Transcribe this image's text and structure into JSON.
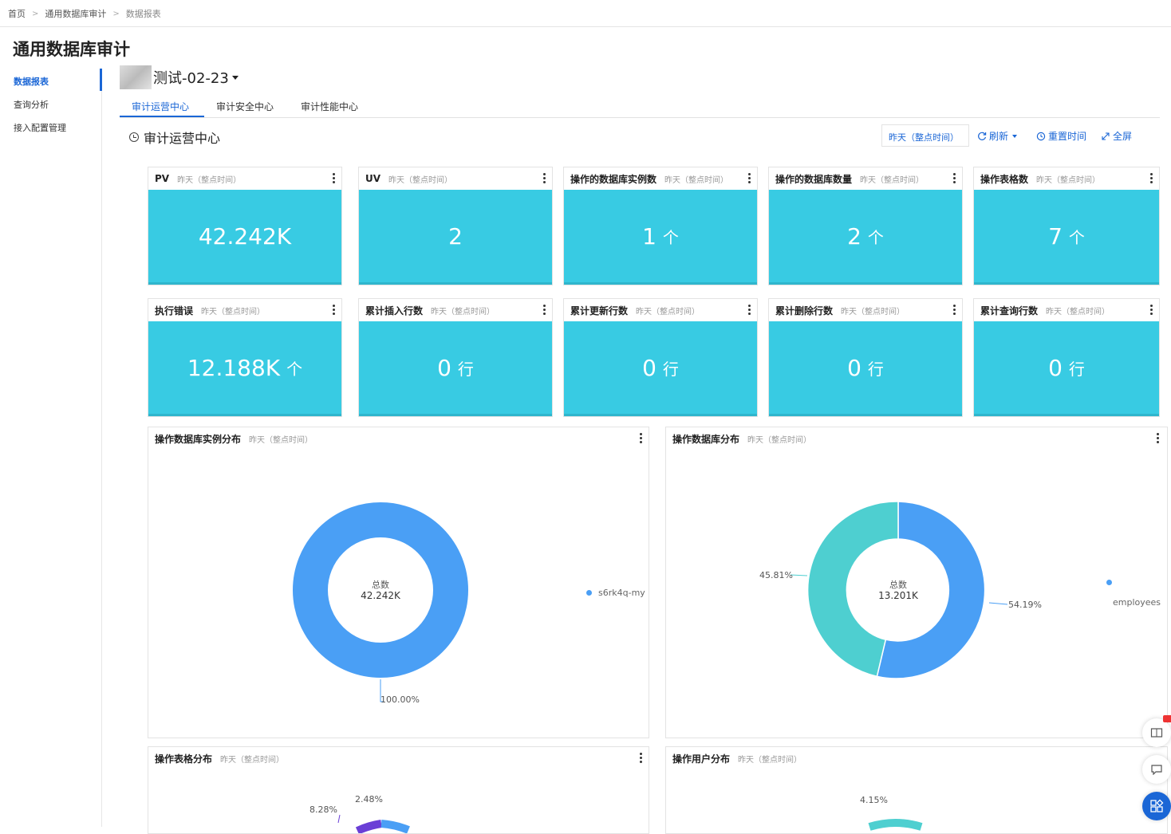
{
  "breadcrumb": [
    "首页",
    "通用数据库审计",
    "数据报表"
  ],
  "page_title": "通用数据库审计",
  "sidebar": {
    "items": [
      {
        "label": "数据报表",
        "active": true
      },
      {
        "label": "查询分析"
      },
      {
        "label": "接入配置管理"
      }
    ]
  },
  "dashboard": {
    "name_suffix": "测试-02-23"
  },
  "tabs": [
    {
      "label": "审计运营中心",
      "active": true
    },
    {
      "label": "审计安全中心"
    },
    {
      "label": "审计性能中心"
    }
  ],
  "section": {
    "title": "审计运营中心"
  },
  "toolbar": {
    "time_range": "昨天（整点时间）",
    "refresh": "刷新",
    "reset_time": "重置时间",
    "fullscreen": "全屏"
  },
  "card_subtitle": "昨天（整点时间）",
  "kpis": [
    {
      "title": "PV",
      "value": "42.242K",
      "unit": ""
    },
    {
      "title": "UV",
      "value": "2",
      "unit": ""
    },
    {
      "title": "操作的数据库实例数",
      "value": "1",
      "unit": "个"
    },
    {
      "title": "操作的数据库数量",
      "value": "2",
      "unit": "个"
    },
    {
      "title": "操作表格数",
      "value": "7",
      "unit": "个"
    },
    {
      "title": "执行错误",
      "value": "12.188K",
      "unit": "个"
    },
    {
      "title": "累计插入行数",
      "value": "0",
      "unit": "行"
    },
    {
      "title": "累计更新行数",
      "value": "0",
      "unit": "行"
    },
    {
      "title": "累计删除行数",
      "value": "0",
      "unit": "行"
    },
    {
      "title": "累计查询行数",
      "value": "0",
      "unit": "行"
    }
  ],
  "charts": {
    "instance_dist": {
      "title": "操作数据库实例分布",
      "center_label": "总数",
      "center_value": "42.242K",
      "legend": [
        "s6rk4q-my"
      ],
      "pct_labels": [
        "100.00%"
      ]
    },
    "db_dist": {
      "title": "操作数据库分布",
      "center_label": "总数",
      "center_value": "13.201K",
      "legend": [
        "",
        "employees"
      ],
      "pct_labels": [
        "45.81%",
        "54.19%"
      ]
    },
    "table_dist": {
      "title": "操作表格分布",
      "pct_labels": [
        "8.28%",
        "2.48%"
      ]
    },
    "user_dist": {
      "title": "操作用户分布",
      "pct_labels": [
        "4.15%"
      ]
    }
  },
  "colors": {
    "accent": "#1a66d6",
    "kpi": "#38cbe3",
    "donut_blue": "#4a9ff5",
    "donut_teal": "#4ecfd0"
  },
  "chart_data": [
    {
      "type": "pie",
      "title": "操作数据库实例分布",
      "categories": [
        "s6rk4q-my"
      ],
      "values": [
        100.0
      ]
    },
    {
      "type": "pie",
      "title": "操作数据库分布",
      "categories": [
        "",
        "employees"
      ],
      "values": [
        54.19,
        45.81
      ]
    }
  ]
}
